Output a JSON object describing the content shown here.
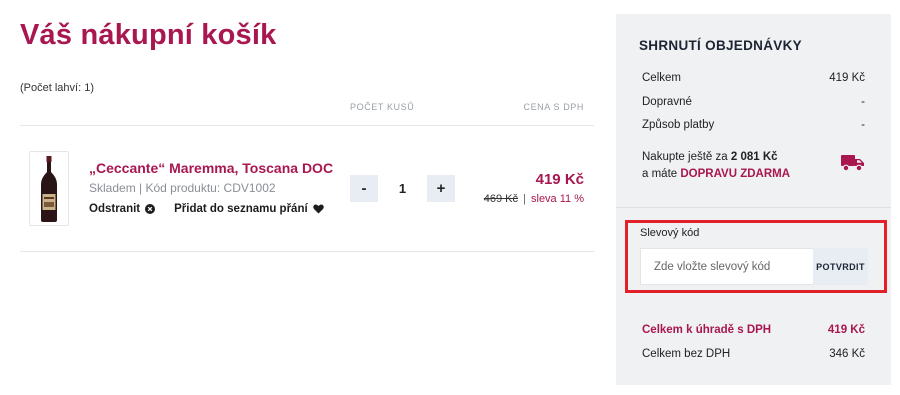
{
  "cart": {
    "title": "Váš nákupní košík",
    "bottle_count": "(Počet lahví: 1)",
    "columns": {
      "quantity": "POČET KUSŮ",
      "price": "CENA S DPH"
    },
    "items": [
      {
        "name": "„Ceccante“ Maremma, Toscana DOC",
        "meta": "Skladem | Kód produktu: CDV1002",
        "remove_label": "Odstranit",
        "wishlist_label": "Přidat do seznamu přání",
        "quantity": "1",
        "minus_label": "-",
        "plus_label": "+",
        "price": "419 Kč",
        "old_price": "469 Kč",
        "separator": "|",
        "discount": "sleva 11 %"
      }
    ]
  },
  "summary": {
    "title": "SHRNUTÍ OBJEDNÁVKY",
    "rows": [
      {
        "label": "Celkem",
        "value": "419 Kč"
      },
      {
        "label": "Dopravné",
        "value": "-"
      },
      {
        "label": "Způsob platby",
        "value": "-"
      }
    ],
    "free_shipping": {
      "line1_prefix": "Nakupte ještě za",
      "line1_amount": "2 081 Kč",
      "line2_prefix": "a máte",
      "line2_strong": "DOPRAVU ZDARMA"
    },
    "coupon": {
      "label": "Slevový kód",
      "placeholder": "Zde vložte slevový kód",
      "button": "POTVRDIT"
    },
    "total_with_vat": {
      "label": "Celkem k úhradě s DPH",
      "value": "419 Kč"
    },
    "total_without_vat": {
      "label": "Celkem bez DPH",
      "value": "346 Kč"
    }
  },
  "colors": {
    "brand": "#a8174f",
    "panel": "#eff1f3",
    "highlight": "#e1202a"
  },
  "icons": [
    "wine-bottle-icon",
    "remove-x-icon",
    "heart-icon",
    "truck-icon"
  ]
}
